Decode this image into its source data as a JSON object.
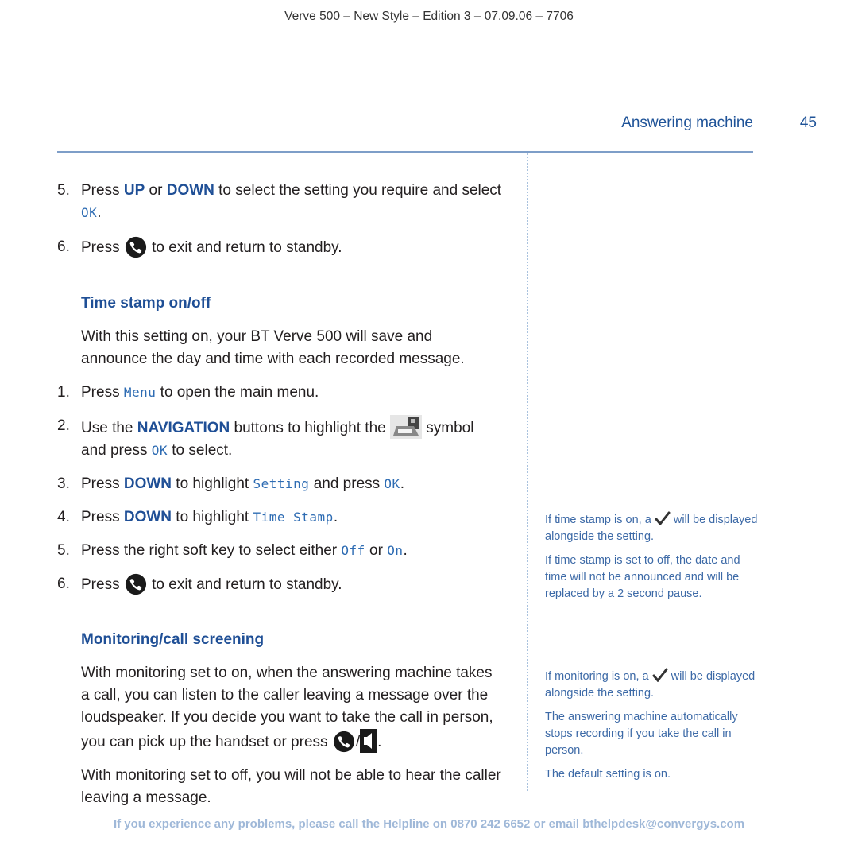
{
  "header": {
    "doc_line": "Verve 500 – New Style – Edition 3 – 07.09.06 – 7706"
  },
  "running_head": {
    "section": "Answering machine",
    "page_number": "45"
  },
  "main": {
    "top_steps": [
      {
        "num": "5.",
        "a": "Press ",
        "kw1": "UP",
        "b": " or ",
        "kw2": "DOWN",
        "c": " to select the setting you require and select ",
        "lcd": "OK",
        "d": "."
      },
      {
        "num": "6.",
        "a": "Press ",
        "icon": "end-call-icon",
        "b": " to exit and return to standby."
      }
    ],
    "time_stamp": {
      "heading": "Time stamp on/off",
      "intro": "With this setting on, your BT Verve 500 will save and announce the day and time with each recorded message.",
      "steps": [
        {
          "num": "1.",
          "a": "Press ",
          "lcd": "Menu",
          "b": " to open the main menu."
        },
        {
          "num": "2.",
          "a": "Use the ",
          "kw": "NAVIGATION",
          "b": " buttons to highlight the ",
          "icon": "answering-machine-icon",
          "c": " symbol and press ",
          "lcd": "OK",
          "d": " to select."
        },
        {
          "num": "3.",
          "a": "Press ",
          "kw": "DOWN",
          "b": " to highlight ",
          "lcd1": "Setting",
          "c": " and press ",
          "lcd2": "OK",
          "d": "."
        },
        {
          "num": "4.",
          "a": "Press ",
          "kw": "DOWN",
          "b": " to highlight ",
          "lcd": "Time Stamp",
          "c": "."
        },
        {
          "num": "5.",
          "a": "Press the right soft key to select either ",
          "lcd1": "Off",
          "b": " or ",
          "lcd2": "On",
          "c": "."
        },
        {
          "num": "6.",
          "a": "Press ",
          "icon": "end-call-icon",
          "b": " to exit and return to standby."
        }
      ]
    },
    "monitoring": {
      "heading": "Monitoring/call screening",
      "para1": "With monitoring set to on, when the answering machine takes a call, you can listen to the caller leaving a message over the loudspeaker. If you decide you want to take the call in person, you can pick up the handset or press ",
      "para1_sep": "/",
      "para1_end": ".",
      "para2": "With monitoring set to off, you will not be able to hear the caller leaving a message."
    }
  },
  "sidebar": {
    "time_stamp_notes": {
      "note1_a": "If time stamp is on, a ",
      "note1_b": " will be displayed alongside the setting.",
      "note2": "If time stamp is set to off, the date and time will not be announced and will be replaced by a 2 second pause."
    },
    "monitoring_notes": {
      "note1_a": "If monitoring is on, a ",
      "note1_b": " will be displayed alongside the setting.",
      "note2": "The answering machine automatically stops recording if you take the call in person.",
      "note3": "The default setting is on."
    }
  },
  "footer": {
    "helpline": "If you experience any problems, please call the Helpline on 0870 242 6652 or email bthelpdesk@convergys.com"
  },
  "colors": {
    "accent_blue": "#1f4f96",
    "lcd_blue": "#2e6cb3",
    "side_blue": "#3d6aa7",
    "footer_blue": "#9fb8d8",
    "rule_blue": "#7e9ec8"
  }
}
